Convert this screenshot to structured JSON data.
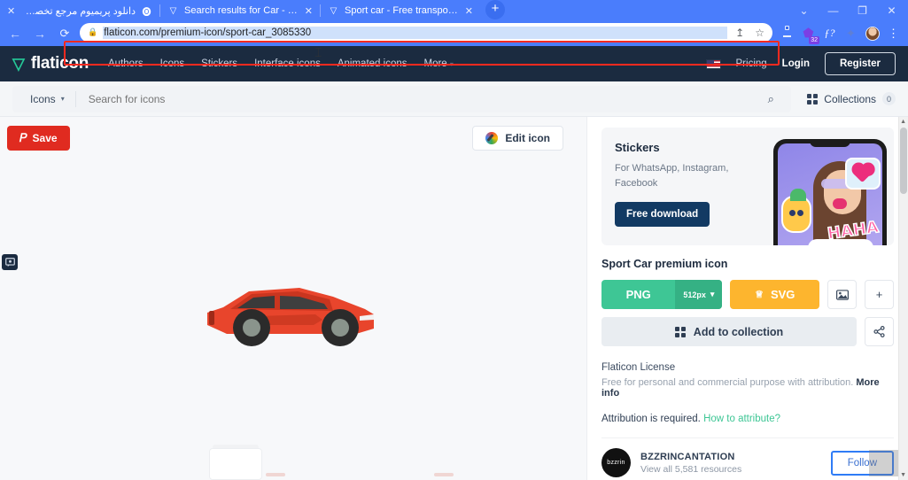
{
  "browser": {
    "tabs": [
      {
        "title": "دانلود پریمیوم مرجع تخصصی دانلو",
        "favicon": "op-icon",
        "rtl": true,
        "active": false
      },
      {
        "title": "Search results for Car - Flaticon",
        "favicon": "flaticon-icon",
        "rtl": false,
        "active": false
      },
      {
        "title": "Sport car - Free transport icons",
        "favicon": "flaticon-icon",
        "rtl": false,
        "active": true
      }
    ],
    "new_tab_label": "+",
    "window_controls": {
      "minimize_chevron": "⌄",
      "minimize": "—",
      "maximize": "❐",
      "close": "✕"
    },
    "nav": {
      "back": "←",
      "forward": "→",
      "reload": "⟳"
    },
    "omnibox": {
      "lock_icon": "lock-icon",
      "url": "flaticon.com/premium-icon/sport-car_3085330",
      "share_icon": "↥",
      "star_icon": "☆"
    },
    "toolbar_icons": [
      {
        "name": "downloads-icon",
        "glyph": "⬓"
      },
      {
        "name": "extension-purple-icon",
        "glyph": "⬟",
        "badge": "32"
      },
      {
        "name": "font-script-icon",
        "glyph": "ƒ?"
      },
      {
        "name": "extensions-puzzle-icon",
        "glyph": "✦"
      },
      {
        "name": "profile-avatar",
        "glyph": ""
      },
      {
        "name": "chrome-menu-icon",
        "glyph": "⋮"
      }
    ]
  },
  "site": {
    "logo": {
      "mark": "▽",
      "text": "flaticon"
    },
    "nav_links": [
      "Authors",
      "Icons",
      "Stickers",
      "Interface icons",
      "Animated icons",
      "More"
    ],
    "more_caret": "▾",
    "flag": "us-flag-icon",
    "pricing": "Pricing",
    "login": "Login",
    "register": "Register"
  },
  "search": {
    "type_selector": "Icons",
    "caret": "▾",
    "placeholder": "Search for icons",
    "value": "",
    "search_icon": "⌕",
    "collections_label": "Collections",
    "collections_count": "0"
  },
  "content": {
    "pinterest_save": "Save",
    "pinterest_glyph": "𝑃",
    "edit_icon_button": "Edit icon",
    "preview_alt": "sport-car-red-icon"
  },
  "panel": {
    "promo": {
      "title": "Stickers",
      "subtitle": "For WhatsApp, Instagram, Facebook",
      "button": "Free download",
      "haha_sticker": "HAHA"
    },
    "icon_title": "Sport Car premium icon",
    "png_button": "PNG",
    "png_size": "512px",
    "png_caret": "▾",
    "svg_button": "SVG",
    "svg_crown": "♕",
    "more_formats_icon": "image-formats-icon",
    "plus_icon": "+",
    "add_to_collection": "Add to collection",
    "share_icon": "share-icon",
    "license": {
      "title": "Flaticon License",
      "text": "Free for personal and commercial purpose with attribution.",
      "more_info": "More info",
      "attribution_text": "Attribution is required.",
      "attribution_link": "How to attribute?"
    },
    "author": {
      "avatar_text": "bzzrin",
      "name": "BZZRINCANTATION",
      "resources": "View all 5,581 resources",
      "follow": "Follow"
    }
  },
  "colors": {
    "brand_dark": "#1b2b40",
    "green": "#3ec695",
    "orange": "#fdb52e",
    "pinterest_red": "#e02b20",
    "highlight_red": "#ff2a1f",
    "browser_blue": "#4a7dfc"
  }
}
